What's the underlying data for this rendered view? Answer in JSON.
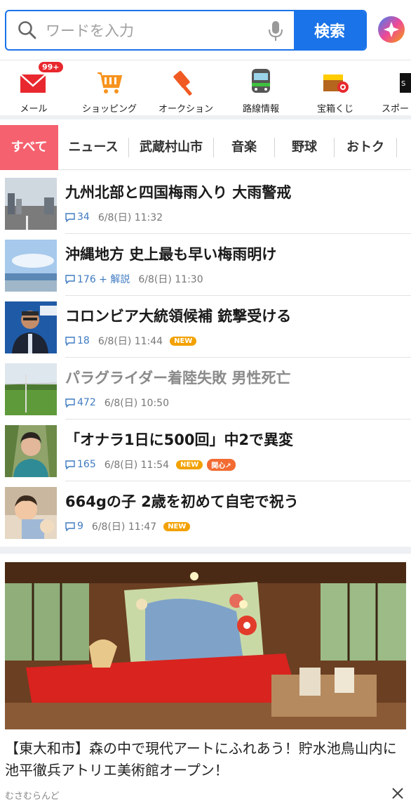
{
  "search": {
    "placeholder": "ワードを入力",
    "button_label": "検索"
  },
  "services": [
    {
      "label": "メール",
      "icon": "mail-icon",
      "badge": "99+"
    },
    {
      "label": "ショッピング",
      "icon": "shopping-cart-icon"
    },
    {
      "label": "オークション",
      "icon": "auction-hammer-icon"
    },
    {
      "label": "路線情報",
      "icon": "train-icon"
    },
    {
      "label": "宝箱くじ",
      "icon": "treasure-chest-icon"
    },
    {
      "label": "スポー",
      "icon": "sports-icon"
    }
  ],
  "tabs": [
    "すべて",
    "ニュース",
    "武蔵村山市",
    "音楽",
    "野球",
    "おトク"
  ],
  "news": [
    {
      "title": "九州北部と四国梅雨入り 大雨警戒",
      "comments": "34",
      "time": "6/8(日) 11:32",
      "tags": [],
      "visited": false
    },
    {
      "title": "沖縄地方 史上最も早い梅雨明け",
      "comments": "176 + 解説",
      "time": "6/8(日) 11:30",
      "tags": [],
      "visited": false
    },
    {
      "title": "コロンビア大統領候補 銃撃受ける",
      "comments": "18",
      "time": "6/8(日) 11:44",
      "tags": [
        "NEW"
      ],
      "visited": false
    },
    {
      "title": "パラグライダー着陸失敗 男性死亡",
      "comments": "472",
      "time": "6/8(日) 10:50",
      "tags": [],
      "visited": true
    },
    {
      "title": "「オナラ1日に500回」中2で異変",
      "comments": "165",
      "time": "6/8(日) 11:54",
      "tags": [
        "NEW",
        "関心↗"
      ],
      "visited": false
    },
    {
      "title": "664gの子 2歳を初めて自宅で祝う",
      "comments": "9",
      "time": "6/8(日) 11:47",
      "tags": [
        "NEW"
      ],
      "visited": false
    }
  ],
  "feature": {
    "title": "【東大和市】森の中で現代アートにふれあう！貯水池鳥山内に池平徹兵アトリエ美術館オープン！",
    "source": "むさむらんど"
  },
  "colors": {
    "accent_blue": "#1a73e8",
    "active_tab": "#f5616e",
    "comment_blue": "#3f7bc1",
    "new_tag": "#f2a100"
  }
}
